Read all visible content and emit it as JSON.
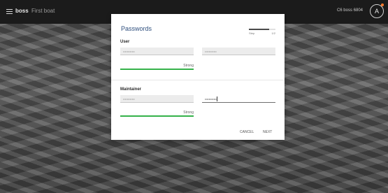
{
  "topbar": {
    "brand": "boss",
    "boat_name": "First boat",
    "right_label": "C6 boss 6804",
    "avatar_initial": "A"
  },
  "dialog": {
    "title": "Passwords",
    "step": {
      "position": "Step",
      "count": "1/2",
      "progress": 0.75
    },
    "user": {
      "label": "User",
      "password_value": "••••••••••••",
      "confirm_value": "••••••••••••",
      "strength": "Strong"
    },
    "maintainer": {
      "label": "Maintainer",
      "password_value": "••••••••••••",
      "confirm_value": "••••••••••••",
      "strength": "Strong"
    },
    "buttons": {
      "cancel": "CANCEL",
      "next": "NEXT"
    }
  },
  "colors": {
    "accent": "#2f4f7e",
    "strength": "#35b24a",
    "avatar_badge": "#ff7a2d"
  }
}
